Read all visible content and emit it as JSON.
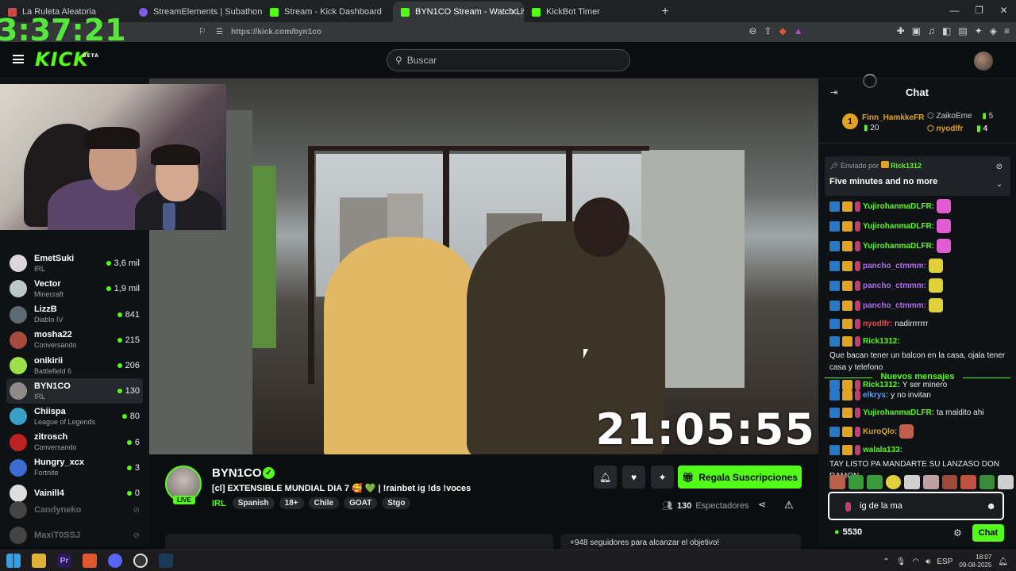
{
  "browser": {
    "tabs": [
      {
        "label": "La Ruleta Aleatoria",
        "color": "#c94c4c"
      },
      {
        "label": "StreamElements | Subathon Countdo",
        "color": "#7a5cf0"
      },
      {
        "label": "Stream - Kick Dashboard",
        "color": "#53fc18"
      },
      {
        "label": "BYN1CO Stream - Watch Live",
        "color": "#53fc18"
      },
      {
        "label": "KickBot Timer",
        "color": "#53fc18"
      }
    ],
    "url": "https://kick.com/byn1co",
    "overlay_clock": "3:37:21"
  },
  "header": {
    "logo": "KICK",
    "beta": "BETA",
    "search_placeholder": "Buscar"
  },
  "sidebar": {
    "items": [
      {
        "name": "",
        "category": "IRL",
        "viewers": "",
        "color": "#555"
      },
      {
        "name": "EmetSuki",
        "category": "IRL",
        "viewers": "3,6 mil",
        "color": "#dcd5e0"
      },
      {
        "name": "Vector",
        "category": "Minecraft",
        "viewers": "1,9 mil",
        "color": "#bcc5c8"
      },
      {
        "name": "LizzB",
        "category": "Diablo IV",
        "viewers": "841",
        "color": "#5c6a73"
      },
      {
        "name": "mosha22",
        "category": "Conversando",
        "viewers": "215",
        "color": "#a84b3e"
      },
      {
        "name": "onikirii",
        "category": "Battlefield 6",
        "viewers": "206",
        "color": "#9ee04a"
      },
      {
        "name": "BYN1CO",
        "category": "IRL",
        "viewers": "130",
        "color": "#8f8a86"
      },
      {
        "name": "Chiispa",
        "category": "League of Legends",
        "viewers": "80",
        "color": "#3aa0c8"
      },
      {
        "name": "zitrosch",
        "category": "Conversando",
        "viewers": "6",
        "color": "#b22"
      },
      {
        "name": "Hungry_xcx",
        "category": "Fortnite",
        "viewers": "3",
        "color": "#3d6bd1"
      },
      {
        "name": "Vainill4",
        "category": "",
        "viewers": "0",
        "color": "#ddd"
      }
    ],
    "offline": [
      {
        "name": "Candyneko",
        "color": "#444"
      },
      {
        "name": "MaxiT0SSJ",
        "color": "#444"
      }
    ]
  },
  "video": {
    "timer": "21:05:55"
  },
  "stream": {
    "channel": "BYN1CO",
    "live": "LIVE",
    "title": "[cl] EXTENSIBLE MUNDIAL DIA 7 🥰 💚 | !rainbet ig !ds !voces",
    "category": "IRL",
    "tags": [
      "Spanish",
      "18+",
      "Chile",
      "GOAT",
      "Stgo"
    ],
    "gift_label": "Regala Suscripciones",
    "viewers_count": "130",
    "viewers_label": "Espectadores",
    "goal_text": "+948 seguidores para alcanzar el objetivo!"
  },
  "chat": {
    "title": "Chat",
    "leaderboard": {
      "first": {
        "rank": "1",
        "name": "Finn_HamkkeFR",
        "count": "20"
      },
      "second": {
        "name": "ZaikoEme",
        "count": "5"
      },
      "third": {
        "name": "nyodlfr",
        "count": "4"
      }
    },
    "pinned": {
      "sent_by": "Enviado por",
      "user": "Rick1312",
      "message": "Five minutes and no more"
    },
    "messages": [
      {
        "user": "YujirohanmaDLFR:",
        "text": "",
        "ucolor": "#53fc18",
        "emote": "#e05cd0"
      },
      {
        "user": "YujirohanmaDLFR:",
        "text": "",
        "ucolor": "#53fc18",
        "emote": "#e05cd0"
      },
      {
        "user": "YujirohanmaDLFR:",
        "text": "",
        "ucolor": "#53fc18",
        "emote": "#e05cd0"
      },
      {
        "user": "pancho_ctmmm:",
        "text": "",
        "ucolor": "#b06cf0",
        "emote": "#e0d03a"
      },
      {
        "user": "pancho_ctmmm:",
        "text": "",
        "ucolor": "#b06cf0",
        "emote": "#e0d03a"
      },
      {
        "user": "pancho_ctmmm:",
        "text": "",
        "ucolor": "#b06cf0",
        "emote": "#e0d03a"
      },
      {
        "user": "nyodlfr:",
        "text": "nadirrrrrrr",
        "ucolor": "#e84848",
        "emote": ""
      },
      {
        "user": "Rick1312:",
        "text": "Que bacan tener un balcon en la casa, ojala tener casa y telefono",
        "ucolor": "#53fc18",
        "emote": ""
      },
      {
        "user": "Rick1312:",
        "text": "Y ser minero",
        "ucolor": "#53fc18",
        "emote": ""
      }
    ],
    "new_messages_label": "Nuevos mensajes",
    "messages2": [
      {
        "user": "elkrys:",
        "text": "y no invitan",
        "ucolor": "#5aa0f0",
        "emote": ""
      },
      {
        "user": "YujirohanmaDLFR:",
        "text": "ta maldito ahi",
        "ucolor": "#53fc18",
        "emote": ""
      },
      {
        "user": "KuroQlo:",
        "text": "",
        "ucolor": "#e0a325",
        "emote": "#c0604a"
      },
      {
        "user": "walala133:",
        "text": "TAY LISTO PA MANDARTE SU LANZASO DON RAMON",
        "ucolor": "#53fc18",
        "emote": ""
      }
    ],
    "input_value": "ig de la ma",
    "points": "5530",
    "send_label": "Chat"
  },
  "taskbar": {
    "lang": "ESP",
    "time": "18:07",
    "date": "09-08-2025"
  }
}
